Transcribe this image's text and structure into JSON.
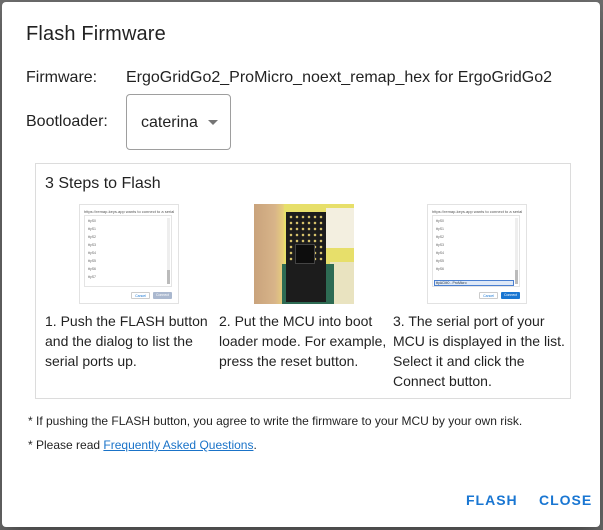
{
  "dialog": {
    "title": "Flash Firmware",
    "firmware_label": "Firmware:",
    "firmware_value": "ErgoGridGo2_ProMicro_noext_remap_hex for ErgoGridGo2",
    "bootloader_label": "Bootloader:",
    "bootloader_value": "caterina"
  },
  "steps": {
    "title": "3 Steps to Flash",
    "items": [
      {
        "text": "1. Push the FLASH button and the dialog to list the serial ports up."
      },
      {
        "text": "2. Put the MCU into boot loader mode. For example, press the reset button."
      },
      {
        "text": "3. The serial port of your MCU is displayed in the list. Select it and click the Connect button."
      }
    ]
  },
  "notes": {
    "risk": "* If pushing the FLASH button, you agree to write the firmware to your MCU by your own risk.",
    "faq_prefix": "* Please read ",
    "faq_link": "Frequently Asked Questions",
    "faq_suffix": "."
  },
  "actions": {
    "flash_label": "FLASH",
    "close_label": "CLOSE"
  },
  "colors": {
    "accent": "#1976d2",
    "link": "#1a73c8"
  }
}
